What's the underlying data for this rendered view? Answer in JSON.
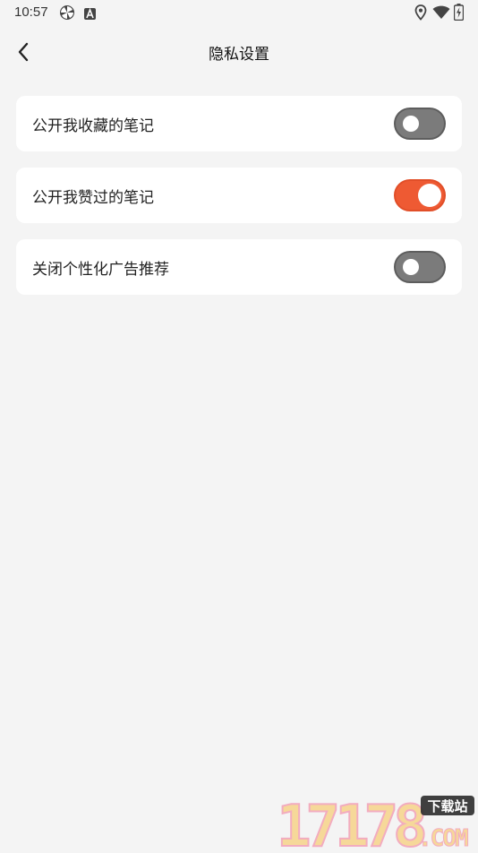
{
  "status_bar": {
    "time": "10:57",
    "icons_left": [
      "pinwheel-icon",
      "a-box-icon"
    ],
    "icons_right": [
      "location-icon",
      "wifi-icon",
      "battery-icon"
    ]
  },
  "nav": {
    "title": "隐私设置",
    "back_icon": "chevron-left-icon"
  },
  "settings": [
    {
      "label": "公开我收藏的笔记",
      "enabled": false
    },
    {
      "label": "公开我赞过的笔记",
      "enabled": true
    },
    {
      "label": "关闭个性化广告推荐",
      "enabled": false
    }
  ],
  "watermark": {
    "number_text": "17178",
    "badge_text": "下载站",
    "suffix_text": ".COM"
  },
  "colors": {
    "background": "#f4f4f4",
    "card": "#ffffff",
    "toggle_on": "#ee5a33",
    "toggle_off": "#7b7b7b",
    "watermark_yellow": "#f7d48a",
    "watermark_pink": "#f2a0b6"
  }
}
